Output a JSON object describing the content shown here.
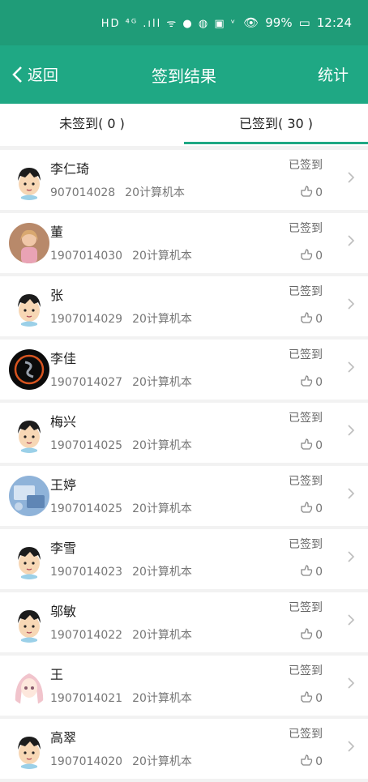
{
  "status_bar": {
    "icons_text": "HD ⁴ᴳ .ıll ᯤ ● ◍ ▣ ᵛ",
    "battery": "99%",
    "time": "12:24"
  },
  "nav": {
    "back_label": "返回",
    "title": "签到结果",
    "stats_label": "统计"
  },
  "tabs": [
    {
      "label": "未签到( 0 )",
      "active": false
    },
    {
      "label": "已签到( 30 )",
      "active": true
    }
  ],
  "students": [
    {
      "name": "李仁琦",
      "id": "907014028",
      "class": "20计算机本",
      "status": "已签到",
      "likes": "0",
      "avatar": "cartoon"
    },
    {
      "name": "董",
      "id": "1907014030",
      "class": "20计算机本",
      "status": "已签到",
      "likes": "0",
      "avatar": "photo-child"
    },
    {
      "name": "张",
      "id": "1907014029",
      "class": "20计算机本",
      "status": "已签到",
      "likes": "0",
      "avatar": "cartoon"
    },
    {
      "name": "李佳",
      "id": "1907014027",
      "class": "20计算机本",
      "status": "已签到",
      "likes": "0",
      "avatar": "dark-emblem"
    },
    {
      "name": "梅兴",
      "id": "1907014025",
      "class": "20计算机本",
      "status": "已签到",
      "likes": "0",
      "avatar": "cartoon"
    },
    {
      "name": "王婷",
      "id": "1907014025",
      "class": "20计算机本",
      "status": "已签到",
      "likes": "0",
      "avatar": "blue-photo"
    },
    {
      "name": "李雪",
      "id": "1907014023",
      "class": "20计算机本",
      "status": "已签到",
      "likes": "0",
      "avatar": "cartoon"
    },
    {
      "name": "邬敏",
      "id": "1907014022",
      "class": "20计算机本",
      "status": "已签到",
      "likes": "0",
      "avatar": "cartoon"
    },
    {
      "name": "王",
      "id": "1907014021",
      "class": "20计算机本",
      "status": "已签到",
      "likes": "0",
      "avatar": "anime-girl"
    },
    {
      "name": "高翠",
      "id": "1907014020",
      "class": "20计算机本",
      "status": "已签到",
      "likes": "0",
      "avatar": "cartoon"
    }
  ],
  "colors": {
    "status_bar": "#1f9c78",
    "nav": "#1fa884",
    "accent": "#1fa884"
  }
}
